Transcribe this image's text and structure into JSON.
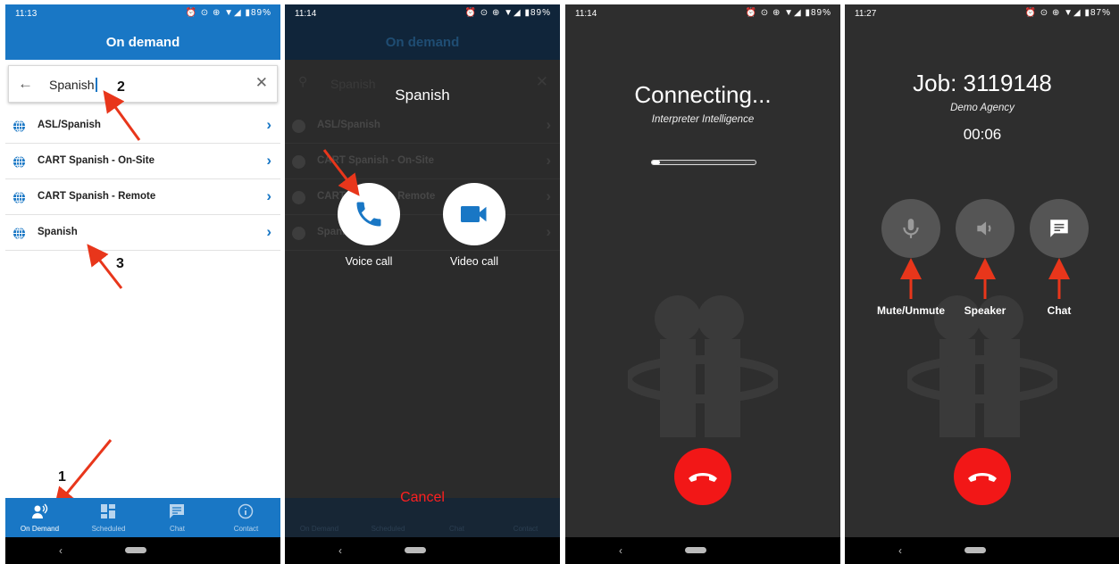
{
  "panel1": {
    "status_time": "11:13",
    "status_icons": "⏰ ⊙ ⊕ ▼◢ ▮89%",
    "title": "On demand",
    "search_query": "Spanish",
    "results": [
      {
        "label": "ASL/Spanish"
      },
      {
        "label": "CART Spanish - On-Site"
      },
      {
        "label": "CART Spanish - Remote"
      },
      {
        "label": "Spanish"
      }
    ],
    "nav": [
      {
        "label": "On Demand",
        "icon": "on-demand-icon"
      },
      {
        "label": "Scheduled",
        "icon": "scheduled-icon"
      },
      {
        "label": "Chat",
        "icon": "chat-icon"
      },
      {
        "label": "Contact",
        "icon": "info-icon"
      }
    ],
    "annotations": [
      "1",
      "2",
      "3"
    ],
    "accent": "#1977c5",
    "chevron_color": "#1977c5"
  },
  "panel2": {
    "status_time": "11:14",
    "status_icons": "⏰ ⊙ ⊕ ▼◢ ▮89%",
    "bg_title": "On demand",
    "bg_search": "Spanish",
    "bg_results": [
      "ASL/Spanish",
      "CART Spanish - On-Site",
      "CART Spanish - Remote",
      "Spanish"
    ],
    "bg_nav": [
      "On Demand",
      "Scheduled",
      "Chat",
      "Contact"
    ],
    "dialog_title": "Spanish",
    "voice_label": "Voice call",
    "video_label": "Video call",
    "cancel_label": "Cancel"
  },
  "panel3": {
    "status_time": "11:14",
    "status_icons": "⏰ ⊙ ⊕ ▼◢ ▮89%",
    "heading": "Connecting...",
    "subtitle": "Interpreter Intelligence",
    "progress": 0.08
  },
  "panel4": {
    "status_time": "11:27",
    "status_icons": "⏰ ⊙ ⊕ ▼◢ ▮87%",
    "job": "Job: 3119148",
    "agency": "Demo Agency",
    "timer": "00:06",
    "controls": [
      {
        "label": "Mute/Unmute",
        "icon": "mic-icon"
      },
      {
        "label": "Speaker",
        "icon": "speaker-icon"
      },
      {
        "label": "Chat",
        "icon": "chat-icon"
      }
    ]
  },
  "colors": {
    "hangup": "#f21717",
    "arrow": "#e8361b"
  }
}
